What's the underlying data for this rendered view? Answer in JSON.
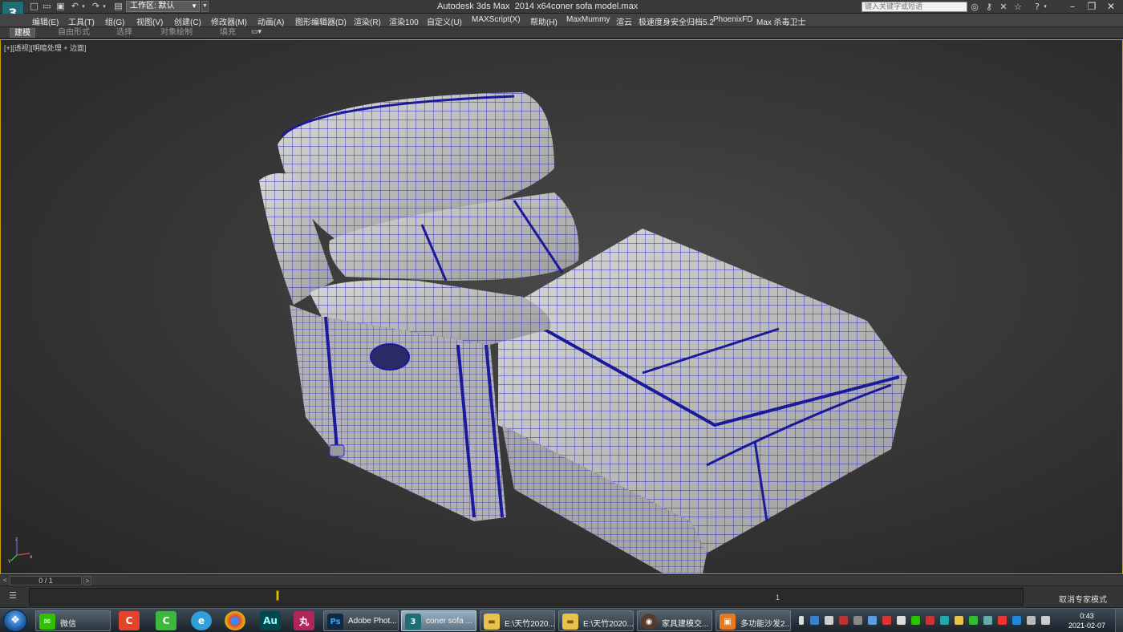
{
  "titlebar": {
    "app_title": "Autodesk 3ds Max  2014 x64",
    "file_title": "coner sofa model.max",
    "workspace_label": "工作区: 默认",
    "search_placeholder": "键入关键字或短语",
    "quick_access_icons": [
      "new-file-icon",
      "open-file-icon",
      "save-icon",
      "undo-icon",
      "undo-history-icon",
      "redo-icon",
      "redo-history-icon",
      "project-folder-icon"
    ],
    "right_icons": [
      "binoculars-icon",
      "key-icon",
      "exchange-icon",
      "star-icon",
      "help-icon"
    ]
  },
  "menubar": {
    "items": [
      "编辑(E)",
      "工具(T)",
      "组(G)",
      "视图(V)",
      "创建(C)",
      "修改器(M)",
      "动画(A)",
      "图形编辑器(D)",
      "渲染(R)",
      "渲染100",
      "自定义(U)",
      "MAXScript(X)",
      "帮助(H)",
      "MaxMummy",
      "渲云",
      "极速度身安全归档5.2",
      "PhoenixFD",
      "Max 杀毒卫士"
    ]
  },
  "ribbon": {
    "tabs": [
      "建模",
      "自由形式",
      "选择",
      "对象绘制",
      "填充"
    ]
  },
  "viewport": {
    "label": "[+][透视][明暗处理 + 边面]",
    "model": "coner sofa (wireframe on shaded)",
    "wire_color": "#2b2bcc",
    "surface_color": "#b9b9b9",
    "axis_labels": [
      "x",
      "y",
      "z"
    ]
  },
  "timeline": {
    "frame": "0 / 1",
    "prev": "<",
    "next": ">",
    "tick_label": "1"
  },
  "status": {
    "expert_mode": "取消专家模式"
  },
  "taskbar": {
    "buttons": [
      {
        "label": "微信",
        "icon": "wechat-icon",
        "color": "#2dc100"
      },
      {
        "label": "Adobe Phot...",
        "icon": "photoshop-icon",
        "color": "#0e2a47"
      },
      {
        "label": "coner sofa ...",
        "icon": "3dsmax-icon",
        "color": "#1f6e74"
      },
      {
        "label": "E:\\天竹2020...",
        "icon": "folder-icon",
        "color": "#e8c24a"
      },
      {
        "label": "E:\\天竹2020...",
        "icon": "folder-icon",
        "color": "#e8c24a"
      },
      {
        "label": "家具建模交...",
        "icon": "chat-avatar-icon",
        "color": "#5a3b2b"
      },
      {
        "label": "多功能沙发2...",
        "icon": "image-viewer-icon",
        "color": "#e67a22"
      }
    ],
    "pinned": [
      {
        "icon": "camtasia-icon",
        "color": "#e2452a"
      },
      {
        "icon": "camtasia-recorder-icon",
        "color": "#3cb93c"
      },
      {
        "icon": "ie-browser-icon",
        "color": "#2fa0d8"
      },
      {
        "icon": "chrome-icon",
        "color": "#db4437"
      },
      {
        "icon": "audition-icon",
        "color": "#00484d"
      },
      {
        "icon": "font-app-icon",
        "color": "#b0265a"
      }
    ],
    "clock_time": "0:43",
    "clock_date": "2021-02-07"
  }
}
